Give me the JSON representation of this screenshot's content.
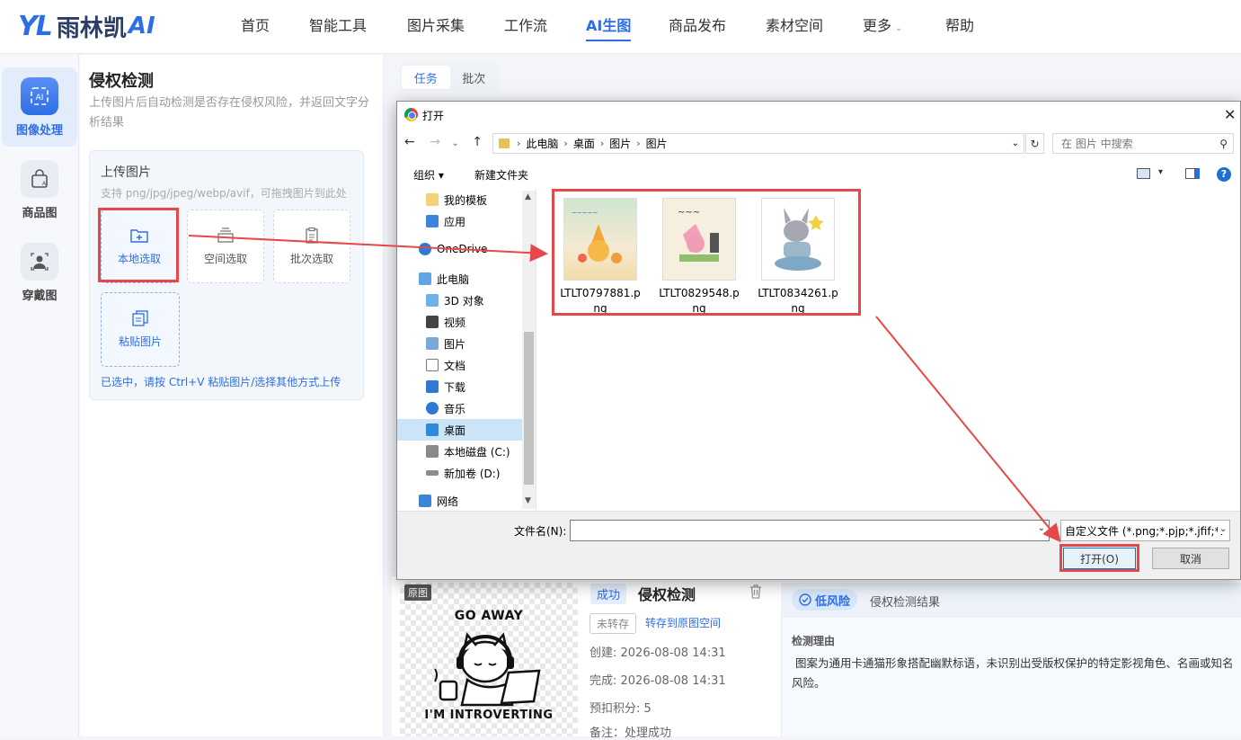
{
  "logo": {
    "mark": "YL",
    "name": "雨林凯",
    "ai": "AI"
  },
  "nav": [
    "首页",
    "智能工具",
    "图片采集",
    "工作流",
    "AI生图",
    "商品发布",
    "素材空间",
    "更多",
    "帮助"
  ],
  "rail": [
    {
      "label": "图像处理",
      "icon": "ai-image-icon"
    },
    {
      "label": "商品图",
      "icon": "shopping-bag-icon"
    },
    {
      "label": "穿戴图",
      "icon": "person-icon"
    }
  ],
  "panel": {
    "title": "侵权检测",
    "desc": "上传图片后自动检测是否存在侵权风险，并返回文字分析结果",
    "upload_title": "上传图片",
    "upload_sub": "支持 png/jpg/jpeg/webp/avif，可拖拽图片到此处",
    "tiles": [
      "本地选取",
      "空间选取",
      "批次选取",
      "粘贴图片"
    ],
    "hint": "已选中，请按 Ctrl+V 粘贴图片/选择其他方式上传"
  },
  "tabs": [
    "任务",
    "批次"
  ],
  "result": {
    "orig_tag": "原图",
    "image_text_top": "GO AWAY",
    "image_text_bottom": "I'M INTROVERTING",
    "status": "成功",
    "title": "侵权检测",
    "unsaved": "未转存",
    "to_space": "转存到原图空间",
    "created": "创建: 2026-08-08 14:31",
    "finished": "完成: 2026-08-08 14:31",
    "points": "预扣积分: 5",
    "note": "备注：处理成功",
    "risk_level": "低风险",
    "risk_label": "侵权检测结果",
    "reason_label": "检测理由",
    "reason": "图案为通用卡通猫形象搭配幽默标语，未识别出受版权保护的特定影视角色、名画或知名风险。"
  },
  "dialog": {
    "title": "打开",
    "path": [
      "此电脑",
      "桌面",
      "图片",
      "图片"
    ],
    "search_placeholder": "在 图片 中搜索",
    "organize": "组织 ▾",
    "new_folder": "新建文件夹",
    "tree": [
      "我的模板",
      "应用",
      "OneDrive",
      "此电脑",
      "3D 对象",
      "视频",
      "图片",
      "文档",
      "下载",
      "音乐",
      "桌面",
      "本地磁盘 (C:)",
      "新加卷 (D:)",
      "网络"
    ],
    "files": [
      "LTLT0797881.png",
      "LTLT0829548.png",
      "LTLT0834261.png"
    ],
    "filename_label": "文件名(N):",
    "filter": "自定义文件 (*.png;*.pjp;*.jfif;*.",
    "open": "打开(O)",
    "cancel": "取消"
  },
  "colors": {
    "accent": "#2d6ee6",
    "highlight": "#e54848"
  }
}
